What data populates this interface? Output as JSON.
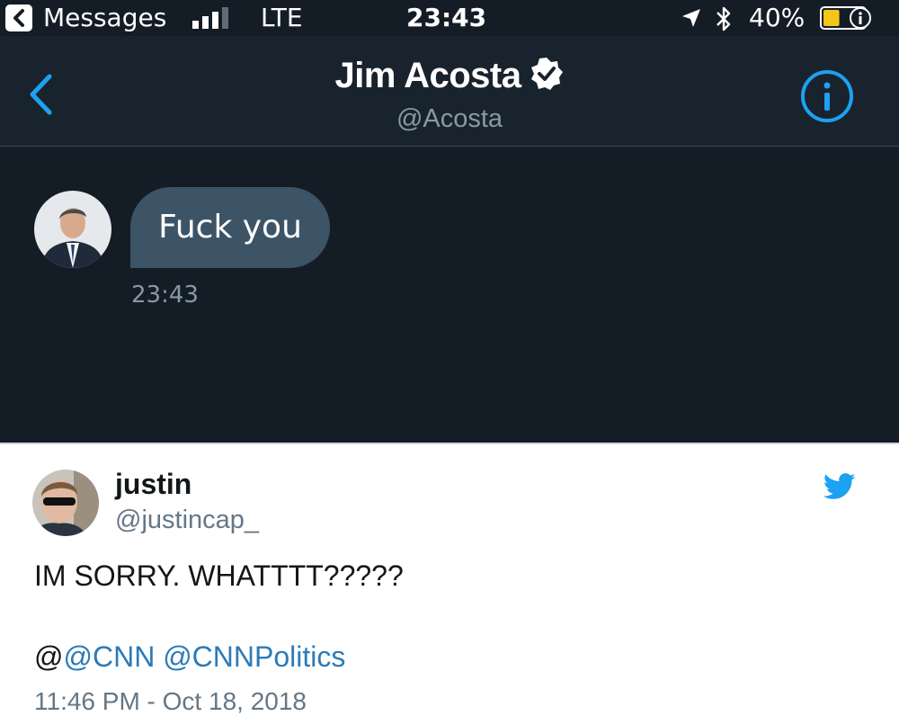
{
  "status_bar": {
    "back_app_label": "Messages",
    "network": "LTE",
    "time": "23:43",
    "battery": "40%",
    "battery_level": 0.4
  },
  "nav": {
    "name": "Jim Acosta",
    "handle": "@Acosta"
  },
  "conversation": {
    "message_text": "Fuck you",
    "message_time": "23:43"
  },
  "tweet": {
    "author_name": "justin",
    "author_handle": "@justincap_",
    "text": "IM SORRY. WHATTTT?????",
    "mention_prefix": "@",
    "mentions": [
      "@CNN",
      "@CNNPolitics"
    ],
    "date": "11:46 PM - Oct 18, 2018"
  },
  "colors": {
    "dm_background": "#141d26",
    "bubble": "#3d5466",
    "twitter_blue": "#1da1f2",
    "link": "#2b7bb9"
  }
}
